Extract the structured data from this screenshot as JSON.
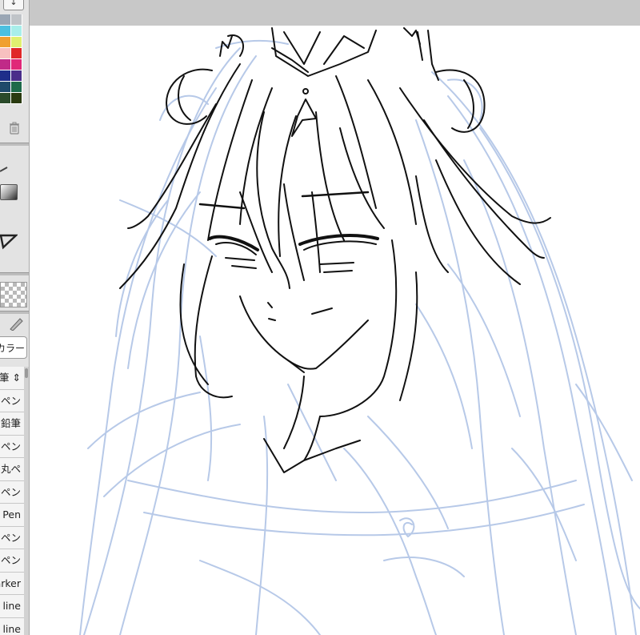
{
  "left_panel": {
    "scroll_arrow": "↓",
    "colors": [
      "#9aa6b4",
      "#c0c4c8",
      "#4cc0e0",
      "#a8eeea",
      "#f0a030",
      "#e0f070",
      "#f8c0c0",
      "#e02828",
      "#c02a88",
      "#e02878",
      "#1e2e8a",
      "#4a2e8a",
      "#1e4a6a",
      "#1e6a4a",
      "#2a4a2a",
      "#2a3a10"
    ],
    "trash_icon": "trash-icon",
    "tool_tab_label": "カラー",
    "brush_items": [
      "筆 ⇕",
      "ペン",
      "鉛筆",
      "ペン",
      "丸ペ",
      "ペン",
      "Pen",
      "ペン",
      "ペン",
      "Marker",
      "line",
      "line"
    ]
  },
  "canvas": {
    "sketch_color": "#b7c9e8",
    "ink_color": "#111111",
    "background": "#ffffff",
    "topbar_color": "#c8c8c8"
  }
}
